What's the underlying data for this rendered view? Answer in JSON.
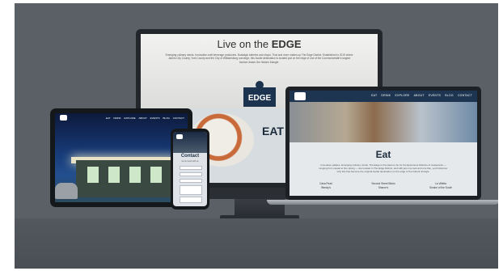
{
  "imac": {
    "headline_prefix": "Live on the",
    "headline_bold": "EDGE",
    "description": "Emerging culinary minds. Innovative craft beverage producers. Nostalgic eateries and shops. That and more makes up The Edge District. Established in 2019 where James City County, York County and the City of Williamsburg converge, this foodie destination is located just on the edge of one of the Commonwealth's largest tourism draws: the historic triangle.",
    "logo": "EDGE",
    "eat_heading": "EAT"
  },
  "laptop": {
    "nav_items": [
      "EAT",
      "DRINK",
      "EXPLORE",
      "ABOUT",
      "EVENTS",
      "BLOG",
      "CONTACT"
    ],
    "heading": "Eat",
    "description": "Innovative palates. Emerging culinary minds. The Edge is the place to be for the Epicurious Districts of restaurants — ranging from casual to fine dining — are located in The Edge District, and with just one look and one bite, you'll discover why this has become the original foodie destination on the edge of the historic triangle.",
    "columns": [
      {
        "name": "Casa Pearl",
        "sub": "Wendy's"
      },
      {
        "name": "Second Street Bistro",
        "sub": "Sharon's"
      },
      {
        "name": "La Villetta",
        "sub": "Smoke of the South"
      }
    ]
  },
  "tablet": {
    "nav_items": [
      "EAT",
      "DRINK",
      "EXPLORE",
      "ABOUT",
      "EVENTS",
      "BLOG",
      "CONTACT"
    ]
  },
  "phone": {
    "heading": "Contact",
    "text": "Get in touch with us"
  },
  "colors": {
    "brand_navy": "#1d3550",
    "background": "#5b6066"
  }
}
